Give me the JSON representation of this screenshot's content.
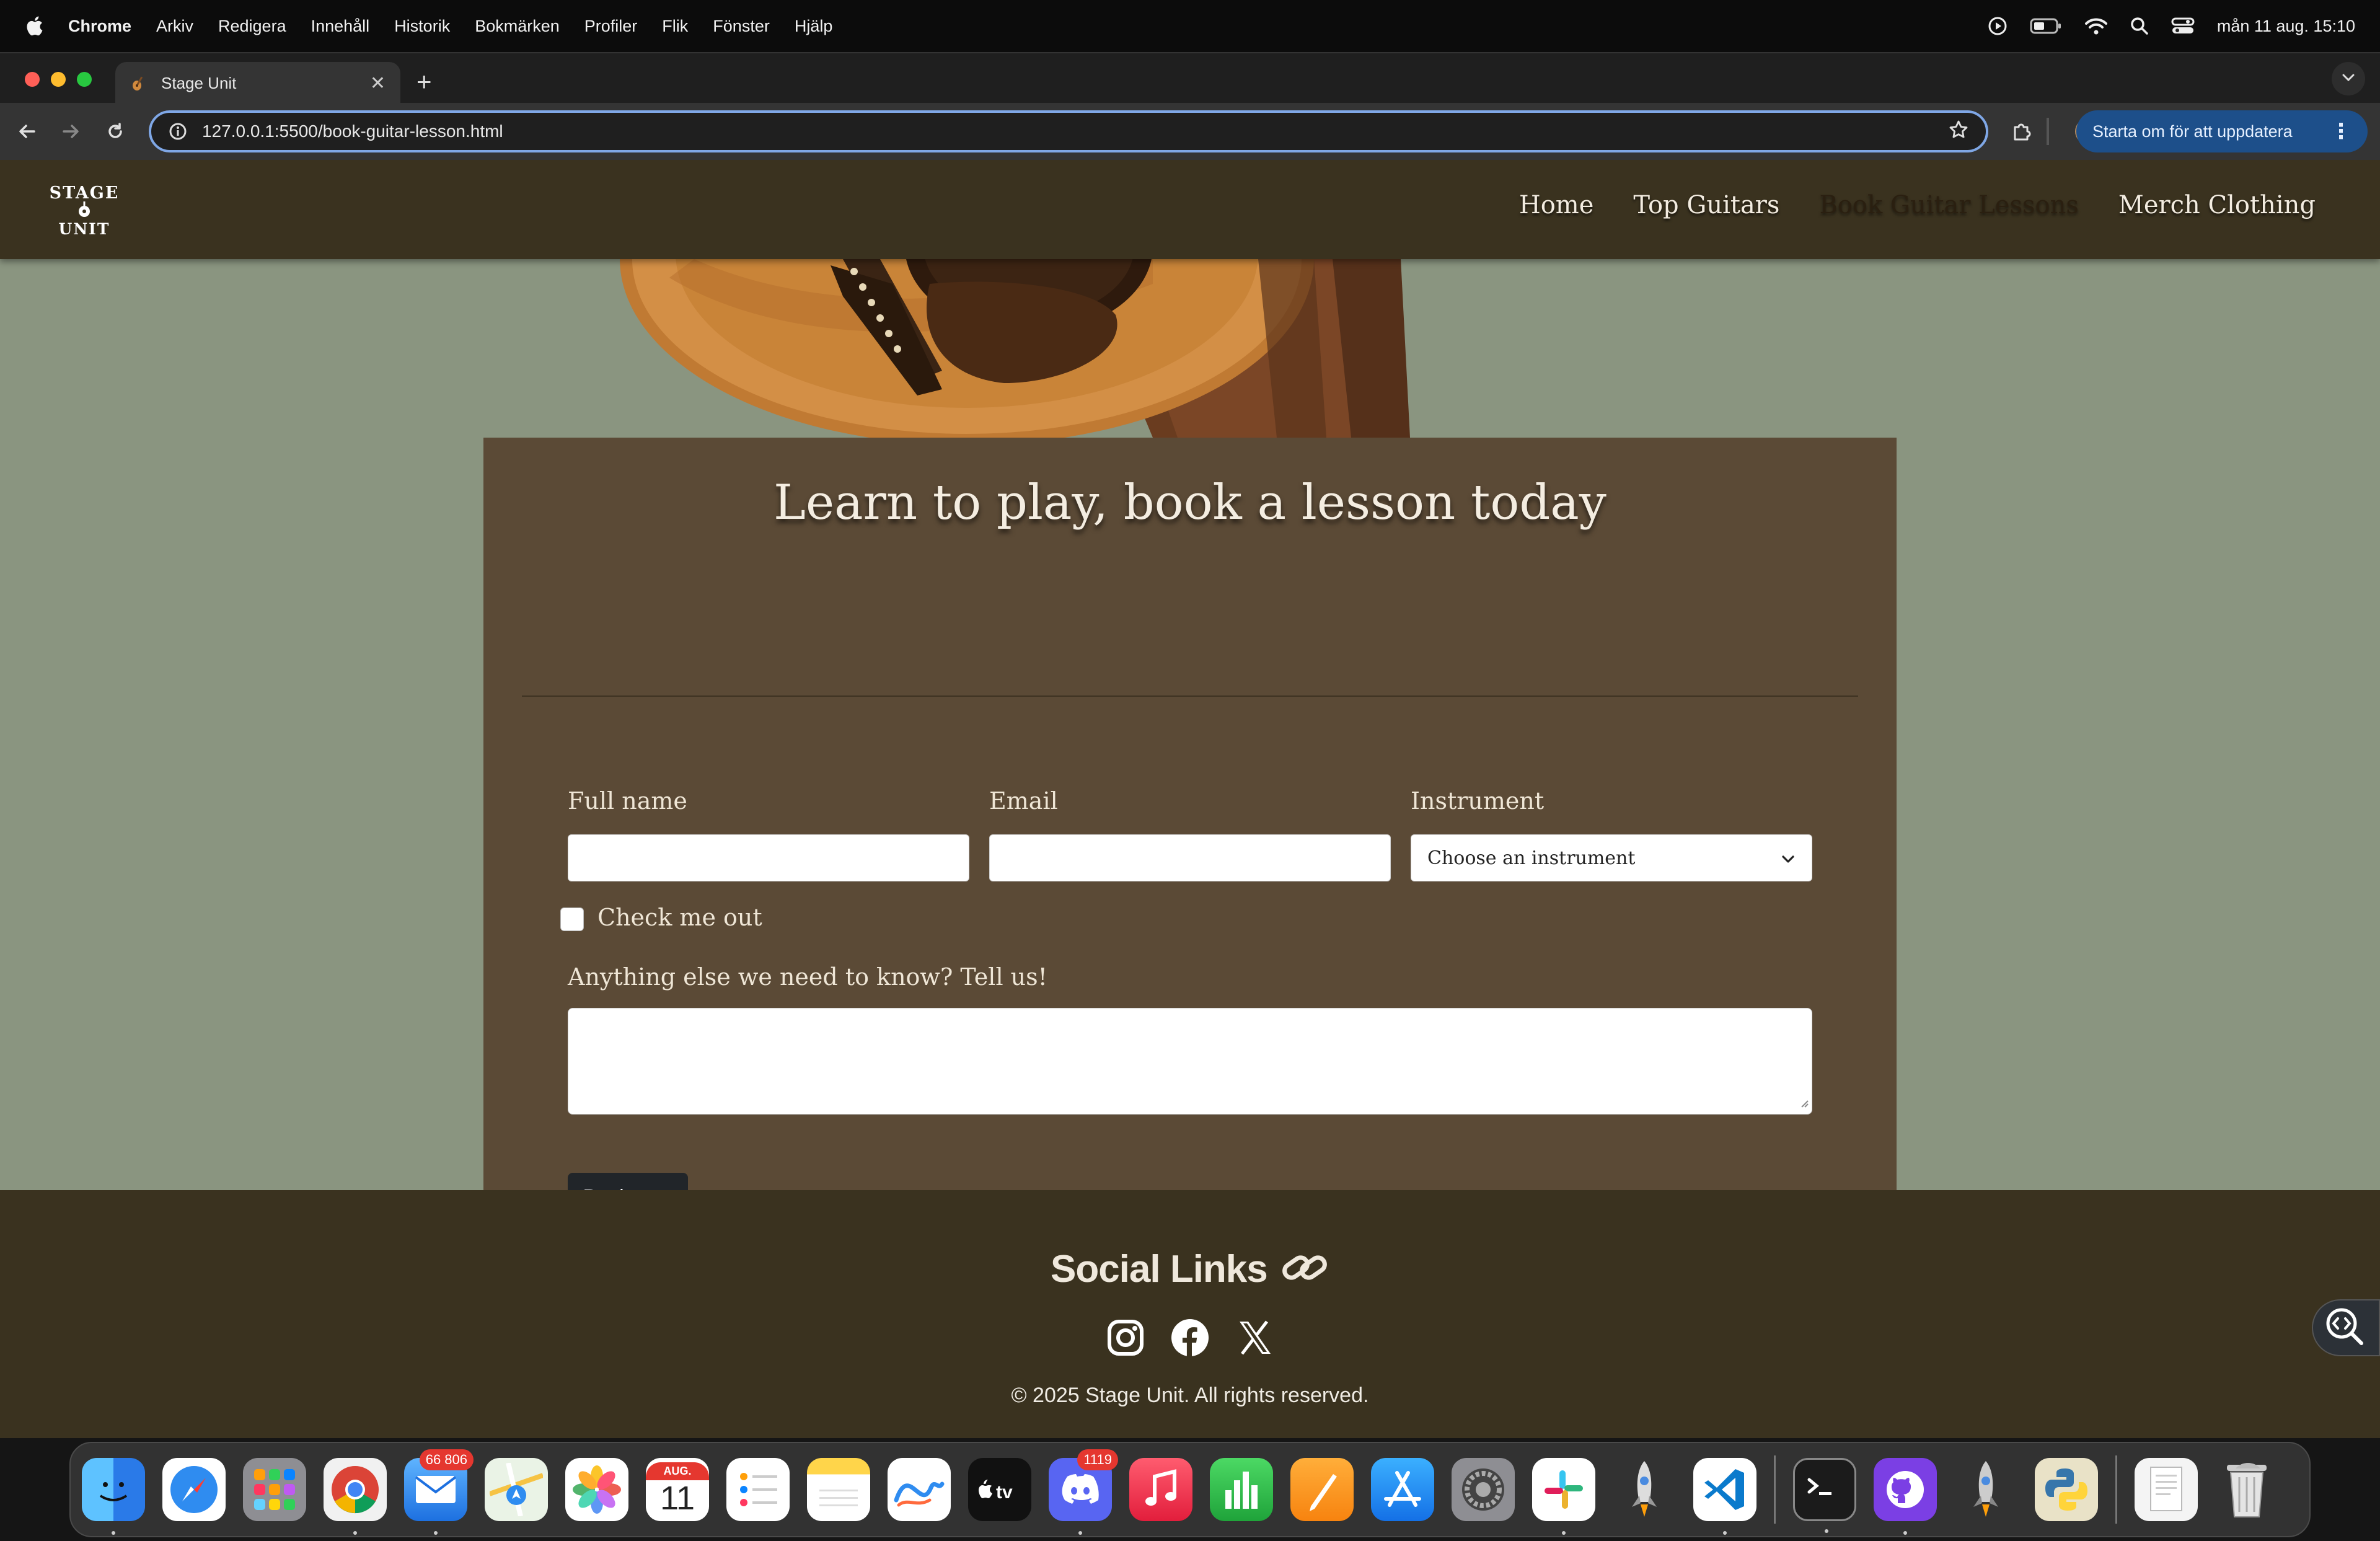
{
  "menubar": {
    "items": [
      "Chrome",
      "Arkiv",
      "Redigera",
      "Innehåll",
      "Historik",
      "Bokmärken",
      "Profiler",
      "Flik",
      "Fönster",
      "Hjälp"
    ],
    "clock": "mån 11 aug. 15:10"
  },
  "browser": {
    "tab_title": "Stage Unit",
    "url": "127.0.0.1:5500/book-guitar-lesson.html",
    "update_button": "Starta om för att uppdatera"
  },
  "site": {
    "logo": {
      "line1": "STAGE",
      "line2": "UNIT"
    },
    "nav": [
      "Home",
      "Top Guitars",
      "Book Guitar Lessons",
      "Merch Clothing"
    ],
    "active_nav": "Book Guitar Lessons"
  },
  "form": {
    "title": "Learn to play, book a lesson today",
    "full_name_label": "Full name",
    "email_label": "Email",
    "instrument_label": "Instrument",
    "instrument_selected": "Choose an instrument",
    "checkbox_label": "Check me out",
    "textarea_label": "Anything else we need to know? Tell us!",
    "submit_label": "Book now"
  },
  "footer": {
    "title": "Social Links",
    "socials": [
      "instagram-icon",
      "facebook-icon",
      "x-icon"
    ],
    "copyright": "© 2025 Stage Unit. All rights reserved."
  },
  "dock": {
    "mail_badge": "66 806",
    "calendar_month": "AUG.",
    "calendar_day": "11",
    "discord_badge": "1119"
  },
  "colors": {
    "page_bg": "#8a9580",
    "nav_bg": "#3a321f",
    "card_bg": "#5b4a36",
    "button_bg": "#212529"
  }
}
